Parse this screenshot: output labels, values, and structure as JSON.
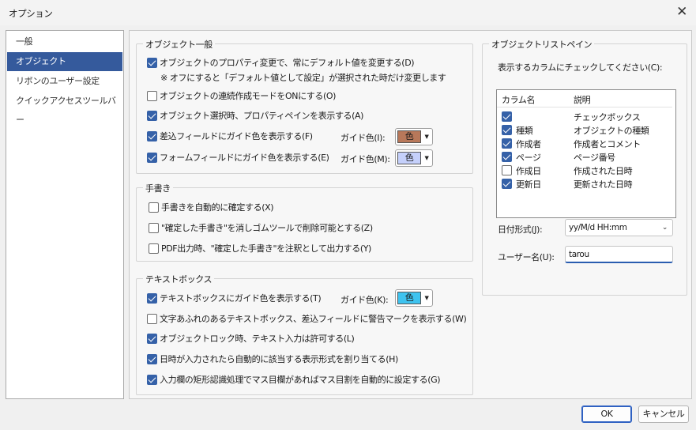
{
  "window": {
    "title": "オプション"
  },
  "sidebar": {
    "items": [
      {
        "label": "一般",
        "selected": false
      },
      {
        "label": "オブジェクト",
        "selected": true
      },
      {
        "label": "リボンのユーザー設定",
        "selected": false
      },
      {
        "label": "クイックアクセスツールバー",
        "selected": false
      }
    ]
  },
  "general_group": {
    "legend": "オブジェクト一般",
    "opt1": {
      "label": "オブジェクトのプロパティ変更で、常にデフォルト値を変更する(D)",
      "checked": true
    },
    "opt1_note": "※ オフにすると「デフォルト値として設定」が選択された時だけ変更します",
    "opt2": {
      "label": "オブジェクトの連続作成モードをONにする(O)",
      "checked": false
    },
    "opt3": {
      "label": "オブジェクト選択時、プロパティペインを表示する(A)",
      "checked": true
    },
    "opt4": {
      "label": "差込フィールドにガイド色を表示する(F)",
      "checked": true
    },
    "opt4_guide": {
      "label": "ガイド色(I):",
      "swatch": "色",
      "color": "#b8785a"
    },
    "opt5": {
      "label": "フォームフィールドにガイド色を表示する(E)",
      "checked": true
    },
    "opt5_guide": {
      "label": "ガイド色(M):",
      "swatch": "色",
      "color": "#c5d0fb"
    }
  },
  "handwriting_group": {
    "legend": "手書き",
    "opt1": {
      "label": "手書きを自動的に確定する(X)",
      "checked": false
    },
    "opt2": {
      "label": "\"確定した手書き\"を消しゴムツールで削除可能とする(Z)",
      "checked": false
    },
    "opt3": {
      "label": "PDF出力時、\"確定した手書き\"を注釈として出力する(Y)",
      "checked": false
    }
  },
  "textbox_group": {
    "legend": "テキストボックス",
    "opt1": {
      "label": "テキストボックスにガイド色を表示する(T)",
      "checked": true
    },
    "opt1_guide": {
      "label": "ガイド色(K):",
      "swatch": "色",
      "color": "#3ec3ef"
    },
    "opt2": {
      "label": "文字あふれのあるテキストボックス、差込フィールドに警告マークを表示する(W)",
      "checked": false
    },
    "opt3": {
      "label": "オブジェクトロック時、テキスト入力は許可する(L)",
      "checked": true
    },
    "opt4": {
      "label": "日時が入力されたら自動的に該当する表示形式を割り当てる(H)",
      "checked": true
    },
    "opt5": {
      "label": "入力欄の矩形認識処理でマス目欄があればマス目割を自動的に設定する(G)",
      "checked": true
    }
  },
  "list_pane": {
    "legend": "オブジェクトリストペイン",
    "instruction": "表示するカラムにチェックしてください(C):",
    "header": {
      "name": "カラム名",
      "desc": "説明"
    },
    "columns": [
      {
        "name": "",
        "desc": "チェックボックス",
        "checked": true
      },
      {
        "name": "種類",
        "desc": "オブジェクトの種類",
        "checked": true
      },
      {
        "name": "作成者",
        "desc": "作成者とコメント",
        "checked": true
      },
      {
        "name": "ページ",
        "desc": "ページ番号",
        "checked": true
      },
      {
        "name": "作成日",
        "desc": "作成された日時",
        "checked": false
      },
      {
        "name": "更新日",
        "desc": "更新された日時",
        "checked": true
      }
    ],
    "date_format": {
      "label": "日付形式(J):",
      "value": "yy/M/d HH:mm"
    },
    "user_name": {
      "label": "ユーザー名(U):",
      "value": "tarou"
    }
  },
  "footer": {
    "ok": "OK",
    "cancel": "キャンセル"
  },
  "colors": {
    "accent": "#3561a8",
    "selection": "#355a9c"
  }
}
